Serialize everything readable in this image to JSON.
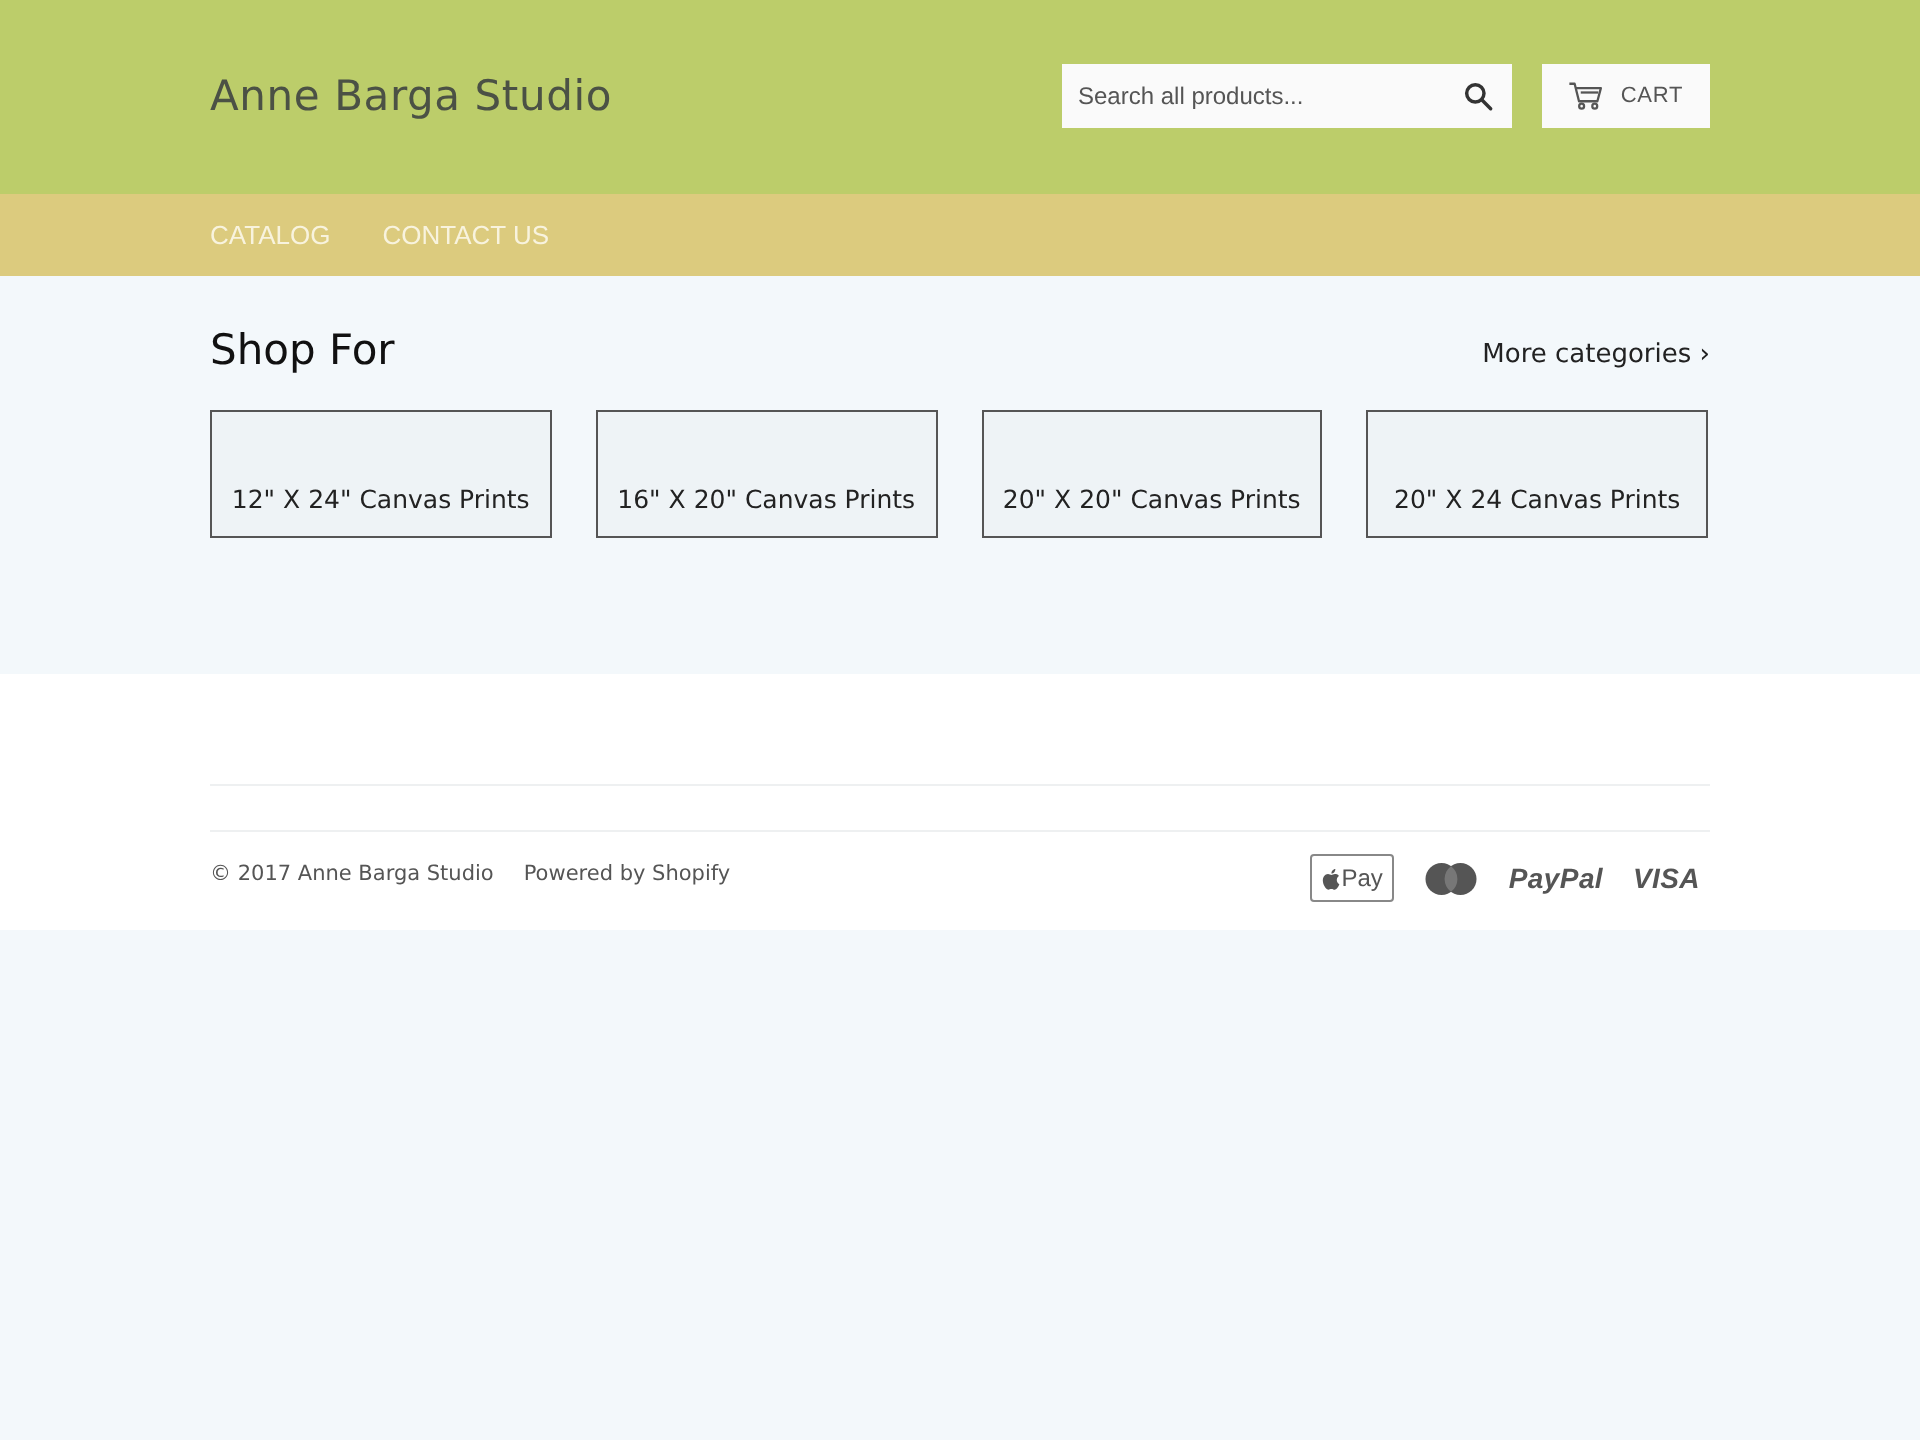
{
  "header": {
    "store_name": "Anne Barga Studio",
    "search": {
      "placeholder": "Search all products..."
    },
    "cart": {
      "label": "CART"
    }
  },
  "nav": {
    "items": [
      {
        "label": "CATALOG"
      },
      {
        "label": "CONTACT US"
      }
    ]
  },
  "collections": {
    "title": "Shop For",
    "more_link": "More categories ›",
    "items": [
      {
        "title": "12\" X 24\" Canvas Prints"
      },
      {
        "title": "16\" X 20\" Canvas Prints"
      },
      {
        "title": "20\" X 20\" Canvas Prints"
      },
      {
        "title": "20\" X 24 Canvas Prints"
      }
    ]
  },
  "footer": {
    "copyright": "© 2017 Anne Barga Studio",
    "powered_by": "Powered by Shopify",
    "payment_icons": [
      {
        "kind": "applepay",
        "label": "Pay"
      },
      {
        "kind": "mastercard"
      },
      {
        "kind": "wordmark",
        "label": "PayPal"
      },
      {
        "kind": "wordmark",
        "label": "VISA"
      }
    ]
  }
}
